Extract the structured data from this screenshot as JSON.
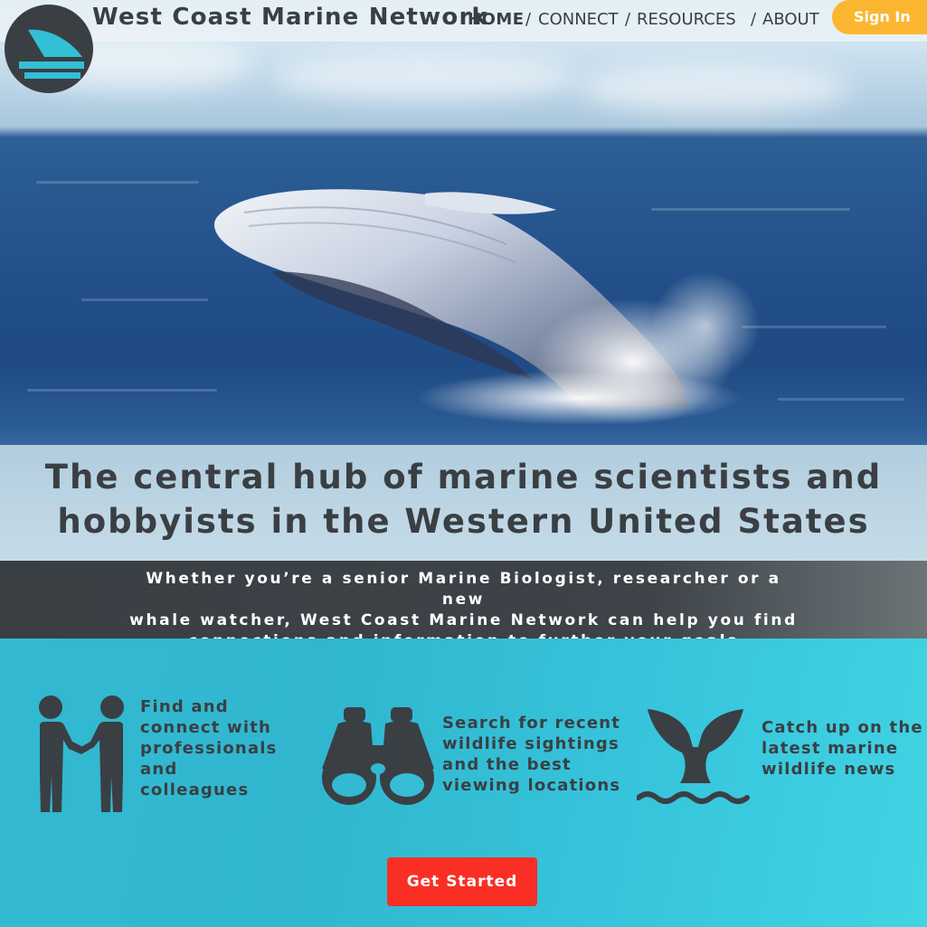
{
  "brand": {
    "name": "West Coast Marine Network"
  },
  "nav": {
    "items": [
      {
        "label": "HOME"
      },
      {
        "label": "CONNECT"
      },
      {
        "label": "RESOURCES"
      },
      {
        "label": "ABOUT"
      }
    ],
    "separator": "/",
    "sign_in": "Sign In"
  },
  "hero": {
    "headline_line1": "The central hub of marine scientists and",
    "headline_line2": "hobbyists in the Western United States"
  },
  "intro": {
    "line1": "Whether you’re a senior Marine Biologist, researcher or a new",
    "line2": "whale watcher, West Coast Marine Network can help you find",
    "line3": "connections and information to further your goals"
  },
  "features": [
    {
      "icon": "handshake-icon",
      "lines": [
        "Find and",
        "connect with",
        "professionals",
        "and",
        "colleagues"
      ]
    },
    {
      "icon": "binoculars-icon",
      "lines": [
        "Search for recent",
        "wildlife sightings",
        "and the best",
        "viewing locations"
      ]
    },
    {
      "icon": "whale-tail-icon",
      "lines": [
        "Catch up on the",
        "latest marine",
        "wildlife news"
      ]
    }
  ],
  "cta": {
    "label": "Get Started"
  },
  "colors": {
    "dark": "#3a3f44",
    "accent_orange": "#fbb631",
    "cta_red": "#f92f25",
    "teal": "#36c3db"
  }
}
